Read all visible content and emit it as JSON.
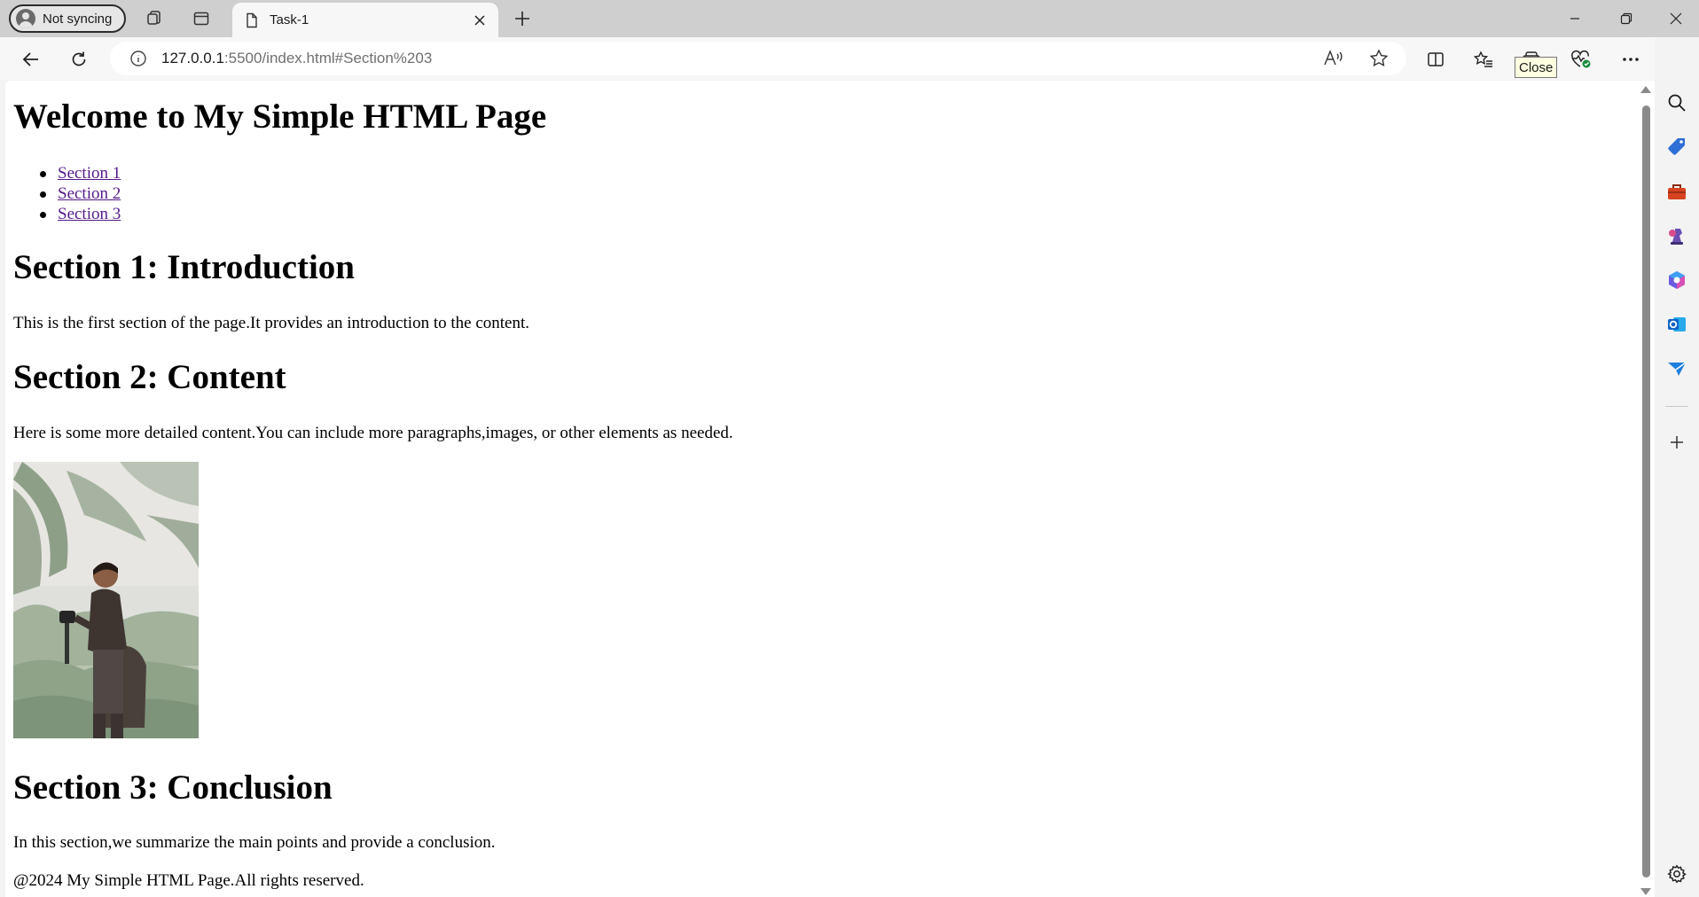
{
  "browser": {
    "profile_label": "Not syncing",
    "tab_title": "Task-1",
    "url_host": "127.0.0.1",
    "url_rest": ":5500/index.html#Section%203",
    "tooltip": "Close"
  },
  "page": {
    "title": "Welcome to My Simple HTML Page",
    "nav": [
      "Section 1",
      "Section 2",
      "Section 3"
    ],
    "section1_heading": "Section 1: Introduction",
    "section1_text": "This is the first section of the page.It provides an introduction to the content.",
    "section2_heading": "Section 2: Content",
    "section2_text": "Here is some more detailed content.You can include more paragraphs,images, or other elements as needed.",
    "section3_heading": "Section 3: Conclusion",
    "section3_text": "In this section,we summarize the main points and provide a conclusion.",
    "footer": "@2024 My Simple HTML Page.All rights reserved."
  },
  "colors": {
    "visited_link": "#551a8b",
    "tab_strip": "#cfcfcf",
    "toolbar": "#f7f7f7"
  }
}
